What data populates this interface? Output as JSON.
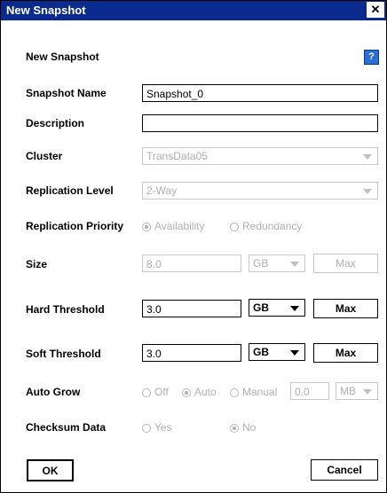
{
  "window": {
    "title": "New Snapshot",
    "close_glyph": "✕"
  },
  "header": {
    "title": "New Snapshot",
    "help_label": "?"
  },
  "fields": {
    "snapshot_name": {
      "label": "Snapshot Name",
      "value": "Snapshot_0"
    },
    "description": {
      "label": "Description",
      "value": ""
    },
    "cluster": {
      "label": "Cluster",
      "value": "TransData05"
    },
    "replication_level": {
      "label": "Replication Level",
      "value": "2-Way"
    },
    "replication_priority": {
      "label": "Replication Priority",
      "options": [
        "Availability",
        "Redundancy"
      ],
      "selected": "Availability"
    },
    "size": {
      "label": "Size",
      "value": "8.0",
      "unit": "GB",
      "max_label": "Max"
    },
    "hard_threshold": {
      "label": "Hard Threshold",
      "value": "3.0",
      "unit": "GB",
      "max_label": "Max"
    },
    "soft_threshold": {
      "label": "Soft Threshold",
      "value": "3.0",
      "unit": "GB",
      "max_label": "Max"
    },
    "auto_grow": {
      "label": "Auto Grow",
      "options": [
        "Off",
        "Auto",
        "Manual"
      ],
      "selected": "Auto",
      "manual_value": "0.0",
      "manual_unit": "MB"
    },
    "checksum_data": {
      "label": "Checksum Data",
      "options": [
        "Yes",
        "No"
      ],
      "selected": "No"
    }
  },
  "buttons": {
    "ok": "OK",
    "cancel": "Cancel"
  },
  "colors": {
    "titlebar": "#0b2a8e",
    "help_icon": "#2b6fd6",
    "disabled_text": "#b0b0b0"
  }
}
